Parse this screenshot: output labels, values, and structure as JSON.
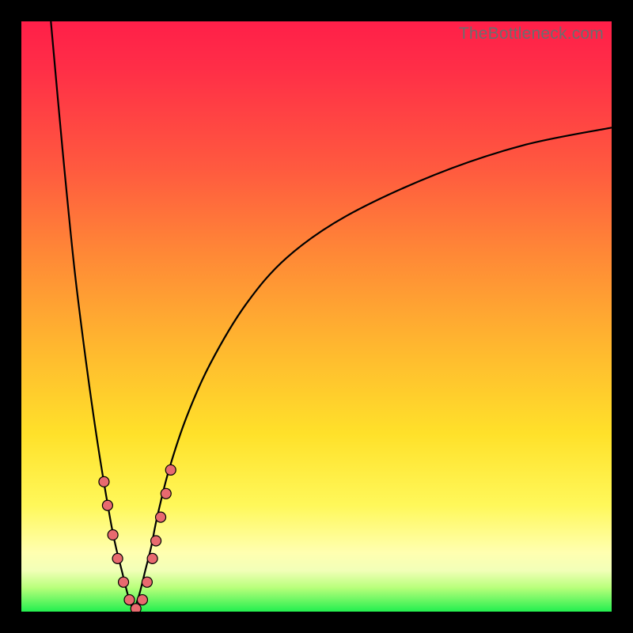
{
  "watermark": "TheBottleneck.com",
  "colors": {
    "frame": "#000000",
    "gradient_top": "#ff1f49",
    "gradient_mid": "#ffe12a",
    "gradient_bottom": "#23ef4f",
    "curve": "#000000",
    "dot_fill": "#e86a6f",
    "dot_stroke": "#000000"
  },
  "chart_data": {
    "type": "line",
    "title": "",
    "xlabel": "",
    "ylabel": "",
    "xlim": [
      0,
      100
    ],
    "ylim": [
      0,
      100
    ],
    "grid": false,
    "legend": false,
    "description": "Bottleneck curve: steep V-shaped dip with minimum near x≈19 (y≈0), rising toward y≈100 at x→0 and asymptotically toward y≈82 as x→100. Color gradient background encodes bottleneck severity (green=low near bottom, red=high near top).",
    "series": [
      {
        "name": "curve-left",
        "x": [
          5,
          7,
          9,
          11,
          13,
          15,
          16,
          17,
          18,
          19
        ],
        "y": [
          100,
          78,
          58,
          42,
          28,
          16,
          11,
          7,
          3,
          0
        ]
      },
      {
        "name": "curve-right",
        "x": [
          19,
          20,
          21,
          22,
          23,
          25,
          28,
          32,
          38,
          45,
          55,
          70,
          85,
          100
        ],
        "y": [
          0,
          3,
          7,
          11,
          16,
          24,
          33,
          42,
          52,
          60,
          67,
          74,
          79,
          82
        ]
      }
    ],
    "markers": [
      {
        "x": 14.0,
        "y": 22
      },
      {
        "x": 14.6,
        "y": 18
      },
      {
        "x": 15.5,
        "y": 13
      },
      {
        "x": 16.3,
        "y": 9
      },
      {
        "x": 17.3,
        "y": 5
      },
      {
        "x": 18.3,
        "y": 2
      },
      {
        "x": 19.4,
        "y": 0.5
      },
      {
        "x": 20.5,
        "y": 2
      },
      {
        "x": 21.3,
        "y": 5
      },
      {
        "x": 22.2,
        "y": 9
      },
      {
        "x": 22.8,
        "y": 12
      },
      {
        "x": 23.6,
        "y": 16
      },
      {
        "x": 24.5,
        "y": 20
      },
      {
        "x": 25.3,
        "y": 24
      }
    ]
  }
}
